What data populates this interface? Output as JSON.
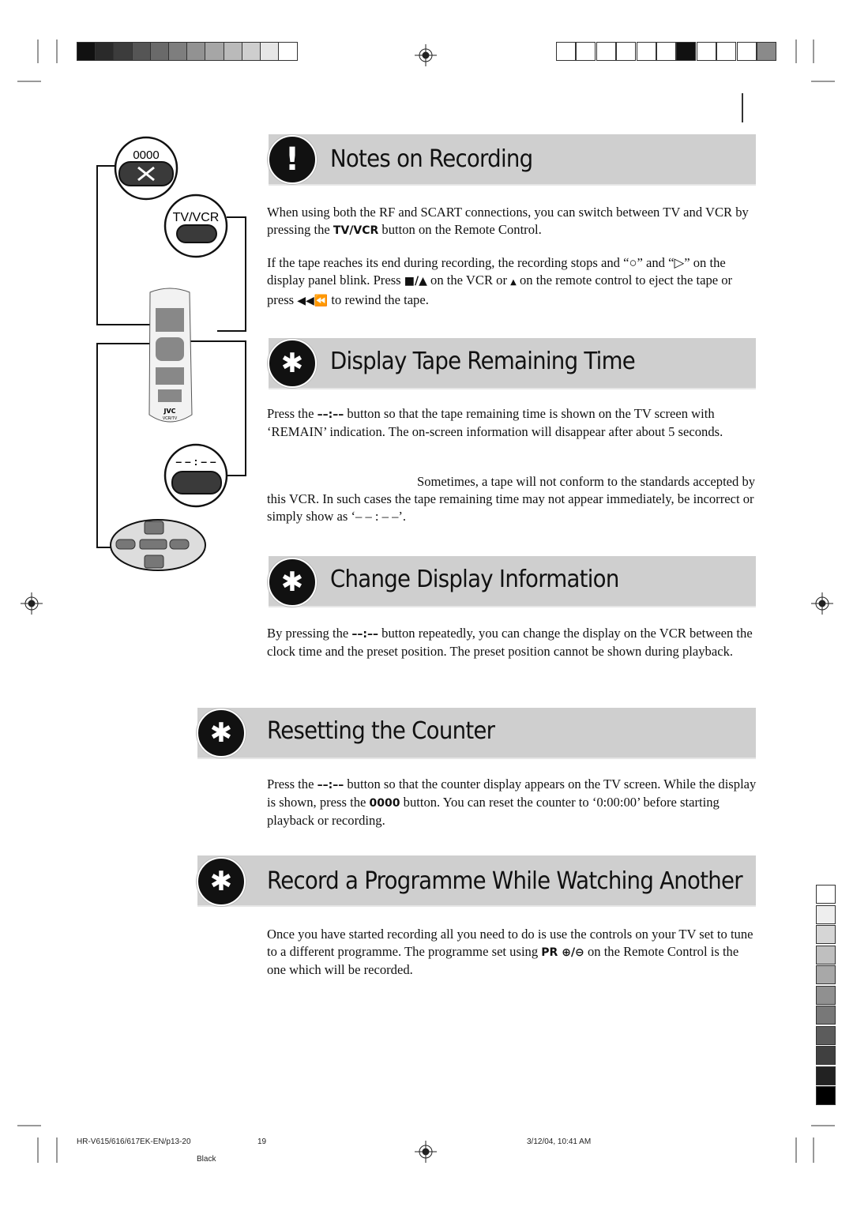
{
  "colors": {
    "bar": "#cfcfcf",
    "icon": "#111111"
  },
  "left_swatches": [
    "#111111",
    "#2a2a2a",
    "#3c3c3c",
    "#555555",
    "#6a6a6a",
    "#7e7e7e",
    "#929292",
    "#a6a6a6",
    "#bababa",
    "#cecece",
    "#e6e6e6",
    "#ffffff"
  ],
  "right_swatches": [
    "#ffffff",
    "#ffffff",
    "#ffffff",
    "#ffffff",
    "#ffffff",
    "#ffffff",
    "#111111",
    "#ffffff",
    "#ffffff",
    "#ffffff",
    "#8a8a8a"
  ],
  "side_swatches": [
    "#ffffff",
    "#eeeeee",
    "#d6d6d6",
    "#bfbfbf",
    "#a8a8a8",
    "#909090",
    "#787878",
    "#5c5c5c",
    "#404040",
    "#222222",
    "#000000"
  ],
  "remote": {
    "reset_label": "0000",
    "tvvcr_label": "TV/VCR",
    "display_label": "– – : – –",
    "brand": "JVC",
    "model": "VCR/TV"
  },
  "sections": [
    {
      "title": "Notes on Recording",
      "icon": "exclamation-icon",
      "glyph": "!"
    },
    {
      "title": "Display Tape Remaining Time",
      "icon": "asterisk-icon",
      "glyph": "✱"
    },
    {
      "title": "Change Display Information",
      "icon": "asterisk-icon",
      "glyph": "✱"
    },
    {
      "title": "Resetting the Counter",
      "icon": "asterisk-icon",
      "glyph": "✱"
    },
    {
      "title": "Record a Programme While Watching Another",
      "icon": "asterisk-icon",
      "glyph": "✱"
    }
  ],
  "paragraphs": {
    "p1": {
      "a": "When using both the RF and SCART connections, you can switch between TV and VCR by pressing the ",
      "b": "TV/VCR",
      "c": " button on the Remote Control."
    },
    "p2": {
      "a": "If the tape reaches its end during recording, the recording stops and “○” and “▷” on the display panel blink. Press ",
      "b": "■/▲",
      "c": " on the VCR or ",
      "d": "▲",
      "e": " on the remote control to eject the tape or press ",
      "f": "◀◀⏪",
      "g": " to rewind the tape."
    },
    "p3": {
      "a": "Press the ",
      "b": "––:––",
      "c": " button so that the tape remaining time is shown on the TV screen with ‘REMAIN’ indication. The on-screen information will disappear after about 5 seconds."
    },
    "p4": {
      "a": "Sometimes, a tape will not conform to the standards accepted by this VCR. In such cases the tape remaining time may not appear immediately, be incorrect or simply show as ‘– – : – –’."
    },
    "p5": {
      "a": "By pressing the ",
      "b": "––:––",
      "c": " button repeatedly, you can change the display on the VCR between the clock time and the preset position. The preset position cannot be shown during playback."
    },
    "p6": {
      "a": "Press the ",
      "b": "––:––",
      "c": " button so that the counter display appears on the TV screen. While the display is shown, press the ",
      "d": "0000",
      "e": " button. You can reset the counter to ‘0:00:00’ before starting playback or recording."
    },
    "p7": {
      "a": "Once you have started recording all you need to do is use the controls on your TV set to tune to a different programme. The programme set using ",
      "b": "PR ⊕/⊖",
      "c": " on the Remote Control is the one which will be recorded."
    }
  },
  "footer": {
    "file": "HR-V615/616/617EK-EN/p13-20",
    "page": "19",
    "date": "3/12/04, 10:41 AM",
    "color": "Black"
  }
}
